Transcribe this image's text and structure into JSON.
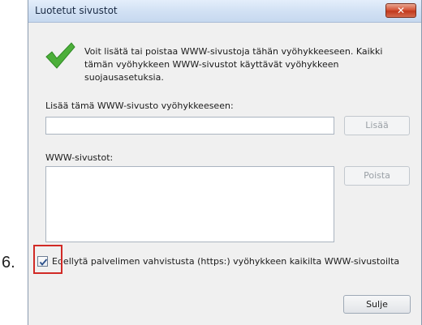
{
  "annotation": {
    "step_number": "6."
  },
  "dialog": {
    "title": "Luotetut sivustot",
    "close_label": "✕",
    "info_text": "Voit lisätä tai poistaa WWW-sivustoja tähän vyöhykkeeseen. Kaikki tämän vyöhykkeen WWW-sivustot käyttävät vyöhykkeen suojausasetuksia.",
    "add_label": "Lisää tämä WWW-sivusto vyöhykkeeseen:",
    "add_input_value": "",
    "add_button": "Lisää",
    "sites_label": "WWW-sivustot:",
    "sites_list": [],
    "remove_button": "Poista",
    "require_https_label": "Edellytä palvelimen vahvistusta (https:) vyöhykkeen kaikilta WWW-sivustoilta",
    "require_https_checked": true,
    "close_button": "Sulje"
  },
  "colors": {
    "checkmark": "#4caf3a",
    "highlight": "#d12a26",
    "titlebar": "#d2e1f4"
  }
}
